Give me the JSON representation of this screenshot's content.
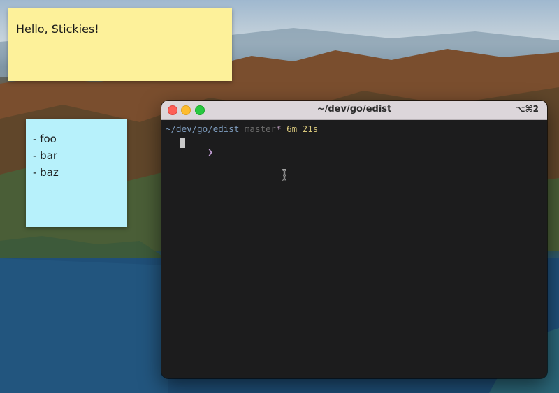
{
  "colors": {
    "sticky_yellow": "#fdf19a",
    "sticky_blue": "#b7f1fb",
    "terminal_bg": "#1c1c1d",
    "prompt_path": "#7e9dbf",
    "prompt_duration": "#d6c57a"
  },
  "stickies": {
    "yellow_note": {
      "text": "Hello, Stickies!"
    },
    "blue_note": {
      "items": [
        "- foo",
        "- bar",
        "- baz"
      ]
    }
  },
  "terminal": {
    "title": "~/dev/go/edist",
    "shortcut": "⌥⌘2",
    "prompt": {
      "path": "~/dev/go/edist",
      "branch": "master",
      "dirty_marker": "*",
      "duration": "6m 21s"
    },
    "input_symbol": "❯",
    "cursor_icon": "text-cursor-icon"
  }
}
